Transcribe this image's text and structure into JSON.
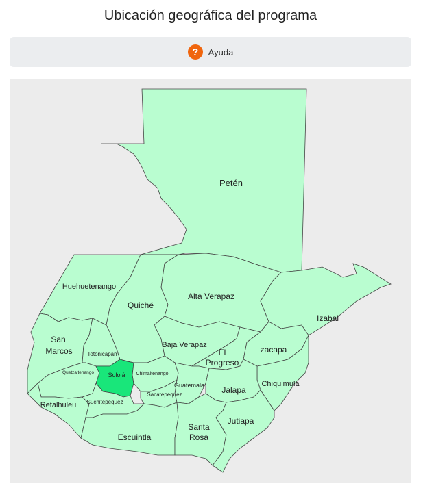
{
  "header": {
    "title": "Ubicación geográfica del programa"
  },
  "help": {
    "icon": "question-circle-icon",
    "label": "Ayuda"
  },
  "map": {
    "selected": "Sololá",
    "colors": {
      "default_fill": "#b9fdd0",
      "selected_fill": "#19e67a",
      "background": "#ececec",
      "help_icon": "#f0650d"
    },
    "departments": {
      "peten": "Petén",
      "huehuetenango": "Huehuetenango",
      "alta_verapaz": "Alta Verapaz",
      "quiche": "Quiché",
      "izabal": "Izabal",
      "san_marcos": "San Marcos",
      "baja_verapaz": "Baja Verapaz",
      "totonicapan": "Totonicapan",
      "el_progreso": "El Progreso",
      "zacapa": "zacapa",
      "quetzaltenango": "Quetzaltenango",
      "solola": "Sololá",
      "chimaltenango": "Chimaltenango",
      "guatemala": "Guatemala",
      "chiquimula": "Chiquimula",
      "sacatepequez": "Sacatepequez",
      "jalapa": "Jalapa",
      "retalhuleu": "Retalhuleu",
      "suchitepequez": "Suchitepequez",
      "escuintla": "Escuintla",
      "santa_rosa": "Santa Rosa",
      "jutiapa": "Jutiapa"
    }
  }
}
